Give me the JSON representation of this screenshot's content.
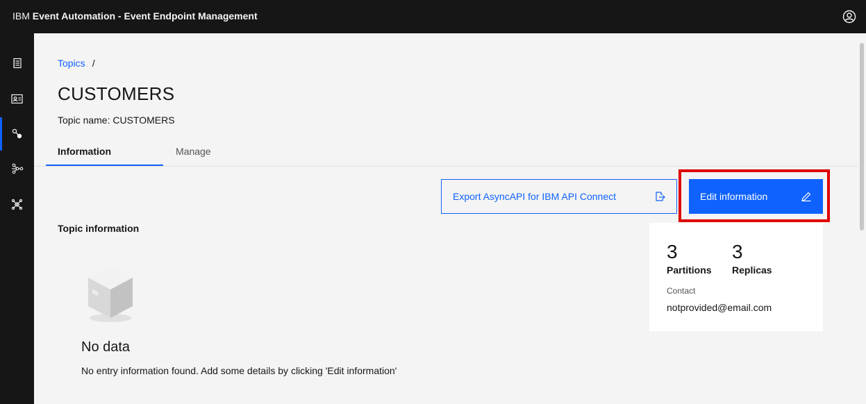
{
  "header": {
    "brand_prefix": "IBM",
    "product": "Event Automation - Event Endpoint Management"
  },
  "sidenav": {
    "items": [
      {
        "icon": "catalog-icon"
      },
      {
        "icon": "subscriptions-card-icon"
      },
      {
        "icon": "topics-icon",
        "active": true
      },
      {
        "icon": "network-icon"
      },
      {
        "icon": "gateway-icon"
      }
    ]
  },
  "breadcrumb": {
    "link": "Topics",
    "separator": "/"
  },
  "page": {
    "title": "CUSTOMERS",
    "topic_name": "Topic name: CUSTOMERS"
  },
  "tabs": [
    {
      "label": "Information",
      "active": true
    },
    {
      "label": "Manage",
      "active": false
    }
  ],
  "actions": {
    "export_label": "Export AsyncAPI for IBM API Connect",
    "edit_label": "Edit information"
  },
  "section": {
    "title": "Topic information"
  },
  "empty_state": {
    "title": "No data",
    "description": "No entry information found. Add some details by clicking 'Edit information'"
  },
  "stats": {
    "partitions": {
      "value": "3",
      "label": "Partitions"
    },
    "replicas": {
      "value": "3",
      "label": "Replicas"
    },
    "contact_label": "Contact",
    "contact_value": "notprovided@email.com"
  },
  "colors": {
    "primary": "#0f62fe",
    "header_bg": "#161616",
    "highlight": "#e00000"
  }
}
